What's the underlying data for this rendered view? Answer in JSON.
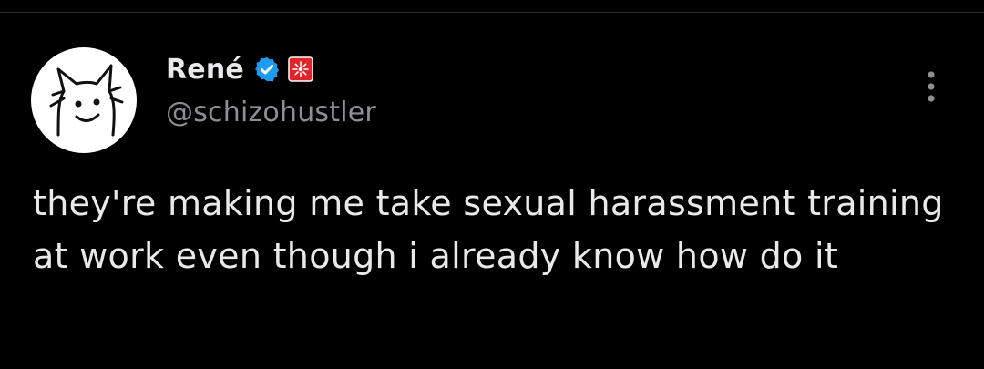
{
  "tweet": {
    "author": {
      "display_name": "René",
      "handle": "@schizohustler",
      "avatar_icon": "cartoon-cat-face-icon",
      "verified_icon": "verified-badge-icon",
      "affiliate_icon": "affiliate-badge-icon"
    },
    "more_icon": "more-vertical-icon",
    "text": "they're making me take sexual harassment training at work even though i already know how do it"
  },
  "colors": {
    "background": "#000000",
    "text_primary": "#e7e9ea",
    "text_secondary": "#8b9095",
    "verified_blue": "#1d9bf0",
    "affiliate_red": "#e0242b"
  }
}
